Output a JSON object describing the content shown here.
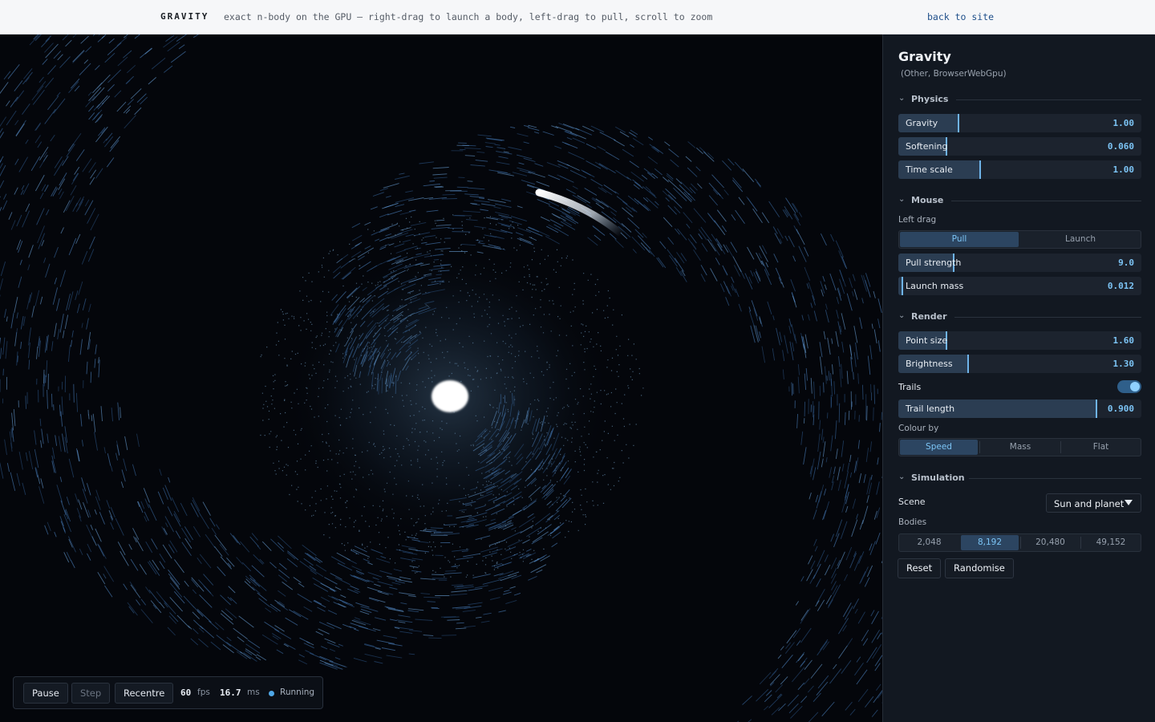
{
  "topbar": {
    "brand": "GRAVITY",
    "tagline": "exact n-body on the GPU — right-drag to launch a body, left-drag to pull, scroll to zoom",
    "back_link": "back to site"
  },
  "toolbar": {
    "pause": "Pause",
    "step": "Step",
    "recentre": "Recentre",
    "fps_value": "60",
    "fps_unit": "fps",
    "ms_value": "16.7",
    "ms_unit": "ms",
    "status": "Running"
  },
  "panel": {
    "title": "Gravity",
    "subtitle": "(Other, BrowserWebGpu)",
    "physics": {
      "heading": "Physics",
      "gravity": {
        "label": "Gravity",
        "value": "1.00",
        "fill": 0.25
      },
      "softening": {
        "label": "Softening",
        "value": "0.060",
        "fill": 0.2
      },
      "time_scale": {
        "label": "Time scale",
        "value": "1.00",
        "fill": 0.34
      }
    },
    "mouse": {
      "heading": "Mouse",
      "left_drag_label": "Left drag",
      "left_drag_options": [
        "Pull",
        "Launch"
      ],
      "left_drag_selected": "Pull",
      "pull_strength": {
        "label": "Pull strength",
        "value": "9.0",
        "fill": 0.23
      },
      "launch_mass": {
        "label": "Launch mass",
        "value": "0.012",
        "fill": 0.02
      }
    },
    "render": {
      "heading": "Render",
      "point_size": {
        "label": "Point size",
        "value": "1.60",
        "fill": 0.2
      },
      "brightness": {
        "label": "Brightness",
        "value": "1.30",
        "fill": 0.29
      },
      "trails_label": "Trails",
      "trails_on": true,
      "trail_length": {
        "label": "Trail length",
        "value": "0.900",
        "fill": 0.82
      },
      "colour_by_label": "Colour by",
      "colour_by_options": [
        "Speed",
        "Mass",
        "Flat"
      ],
      "colour_by_selected": "Speed"
    },
    "simulation": {
      "heading": "Simulation",
      "scene_label": "Scene",
      "scene_value": "Sun and planet",
      "bodies_label": "Bodies",
      "bodies_options": [
        "2,048",
        "8,192",
        "20,480",
        "49,152"
      ],
      "bodies_selected": "8,192",
      "reset": "Reset",
      "randomise": "Randomise"
    }
  },
  "colors": {
    "accent": "#7cc4f5",
    "slider_fill": "#2b3d52",
    "particle": "#4f86c4"
  },
  "icons": {
    "section_chevron": "chevron-down-icon",
    "scene_caret": "caret-down-icon",
    "status": "status-dot-icon"
  }
}
